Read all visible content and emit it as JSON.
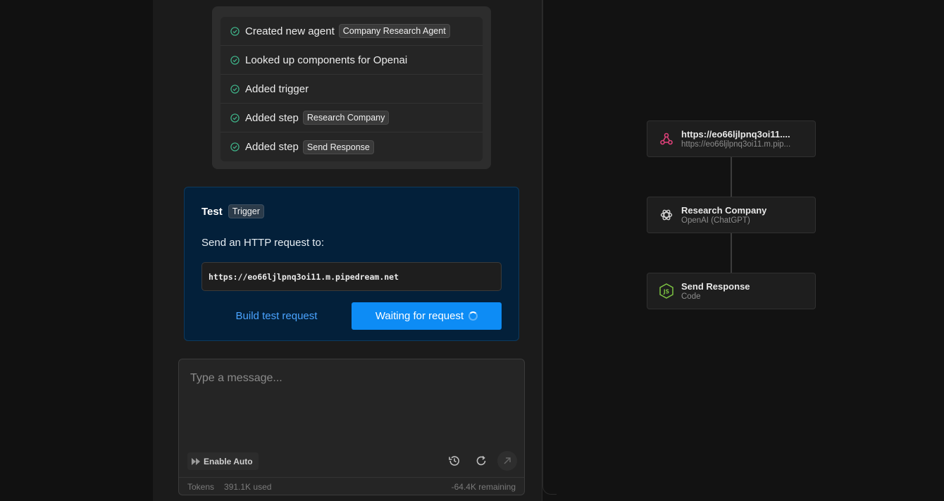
{
  "activity": [
    {
      "text": "Created new agent",
      "tag": "Company Research Agent"
    },
    {
      "text": "Looked up components for Openai",
      "tag": ""
    },
    {
      "text": "Added trigger",
      "tag": ""
    },
    {
      "text": "Added step",
      "tag": "Research Company"
    },
    {
      "text": "Added step",
      "tag": "Send Response"
    }
  ],
  "test": {
    "title": "Test",
    "tag": "Trigger",
    "send_label": "Send an HTTP request to:",
    "url": "https://eo66ljlpnq3oi11.m.pipedream.net",
    "build_button": "Build test request",
    "waiting_button": "Waiting for request"
  },
  "composer": {
    "placeholder": "Type a message...",
    "auto_button": "Enable Auto",
    "tokens_label": "Tokens",
    "tokens_used": "391.1K used",
    "tokens_remaining": "-64.4K remaining"
  },
  "workflow": [
    {
      "title": "https://eo66ljlpnq3oi11....",
      "subtitle": "https://eo66ljlpnq3oi11.m.pip...",
      "icon": "webhook-icon"
    },
    {
      "title": "Research Company",
      "subtitle": "OpenAI (ChatGPT)",
      "icon": "openai-icon"
    },
    {
      "title": "Send Response",
      "subtitle": "Code",
      "icon": "nodejs-icon"
    }
  ],
  "colors": {
    "accent": "#0d8cf5",
    "link": "#4aa3ff",
    "success": "#3fb68b",
    "test_card_bg": "#03203a"
  }
}
